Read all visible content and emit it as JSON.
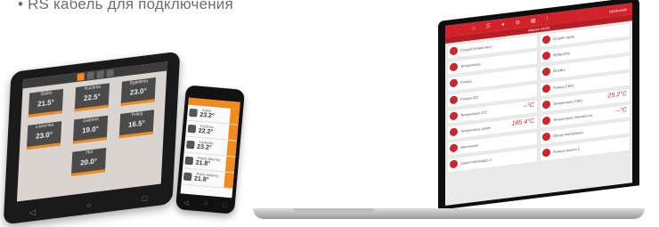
{
  "caption": "• RS кабель для подключения",
  "tablet": {
    "tiles": [
      {
        "name": "Salon",
        "value": "21.5°"
      },
      {
        "name": "Kuchnia",
        "value": "22.5°"
      },
      {
        "name": "Sypialnia",
        "value": "23.0°"
      },
      {
        "name": "Łazienka",
        "value": "23.0°"
      },
      {
        "name": "Gabinet",
        "value": "19.0°"
      },
      {
        "name": "Pokój",
        "value": "16.5°"
      },
      {
        "name": "Hol",
        "value": "20.0°"
      }
    ]
  },
  "phone": {
    "rows": [
      {
        "name": "Salon",
        "value": "23.2°"
      },
      {
        "name": "Kuchnia",
        "value": "22.2°"
      },
      {
        "name": "Łazienka",
        "value": "23.2°"
      },
      {
        "name": "Pokój dzienny",
        "value": "21.8°"
      },
      {
        "name": "Pokój dzienny",
        "value": "21.8°"
      }
    ]
  },
  "laptop": {
    "sub_header": "Wtorek 14:00",
    "account": "Użytkownik",
    "cells": [
      {
        "label": "Czujnik temperatury",
        "value": ""
      },
      {
        "label": "Czujnik ognia",
        "value": ""
      },
      {
        "label": "Temperatura",
        "value": ""
      },
      {
        "label": "Wyłączony",
        "value": ""
      },
      {
        "label": "Pompa",
        "value": ""
      },
      {
        "label": "Grzałka",
        "value": ""
      },
      {
        "label": "Pompa CO",
        "value": ""
      },
      {
        "label": "Pompa CWU",
        "value": ""
      },
      {
        "label": "Temperatura CO",
        "value": "--°C"
      },
      {
        "label": "Temperatura CWU",
        "value": "25.2°C"
      },
      {
        "label": "Temperatura spalin",
        "value": "185.4°C"
      },
      {
        "label": "Temperatura zewnętrzna",
        "value": "--°C"
      },
      {
        "label": "Sterowanie",
        "value": ""
      },
      {
        "label": "Obroty wentylatora",
        "value": ""
      },
      {
        "label": "Zawór mieszający 1",
        "value": ""
      },
      {
        "label": "Pompa zaworu 1",
        "value": ""
      }
    ]
  }
}
